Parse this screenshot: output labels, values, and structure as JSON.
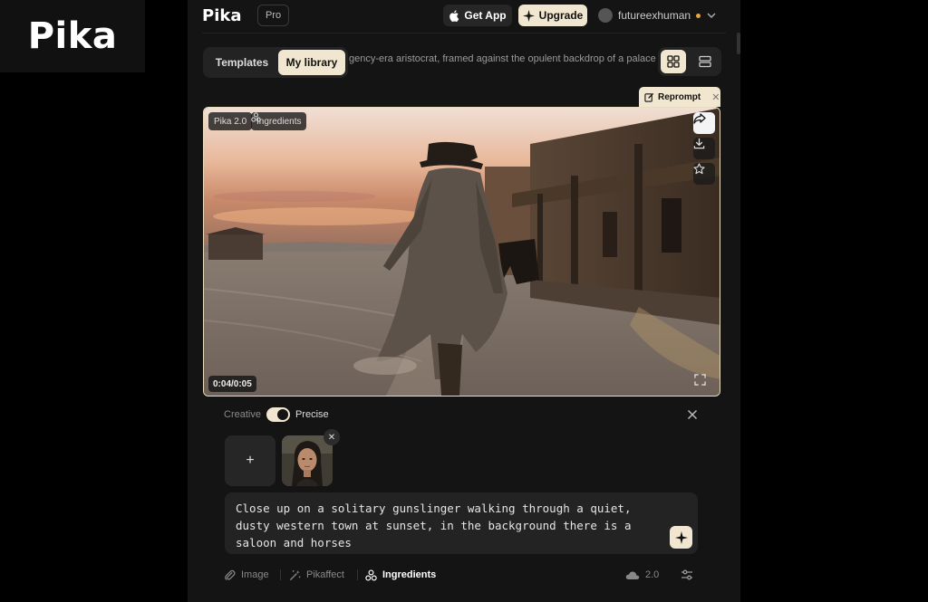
{
  "watermark": {
    "text": "Pika"
  },
  "topbar": {
    "logo": "Pika",
    "plan": "Pro",
    "get_app": "Get App",
    "upgrade": "Upgrade",
    "username": "futureexhuman",
    "icons": {
      "get_app": "apple-icon",
      "upgrade": "sparkle-icon",
      "menu": "chevron-down-icon"
    }
  },
  "tabs": [
    {
      "label": "Templates",
      "active": false
    },
    {
      "label": "My library",
      "active": true
    }
  ],
  "prompt_preview": "gency-era aristocrat, framed against the opulent backdrop of a palace",
  "view_modes": [
    "grid-icon",
    "list-icon"
  ],
  "reprompt": {
    "label": "Reprompt",
    "icon": "edit-icon"
  },
  "video": {
    "model_badge": "Pika 2.0",
    "ingredients_badge": "Ingredients",
    "timecode": "0:04/0:05",
    "actions": [
      "share-icon",
      "download-icon",
      "star-icon"
    ],
    "progress": 0.8
  },
  "settings": {
    "mode_left": "Creative",
    "mode_right": "Precise",
    "precise_enabled": true
  },
  "ingredients": {
    "add_label": "+",
    "items": [
      {
        "type": "image",
        "subject": "portrait"
      }
    ]
  },
  "prompt": {
    "text": "Close up on a solitary gunslinger walking through a quiet, dusty western town at sunset, in the background there is a saloon and horses"
  },
  "toolbar": {
    "image": "Image",
    "pikaffect": "Pikaffect",
    "ingredients": "Ingredients",
    "model_version": "2.0"
  },
  "colors": {
    "accent": "#f1e6cf",
    "panel": "#141414",
    "surface": "#232323"
  }
}
